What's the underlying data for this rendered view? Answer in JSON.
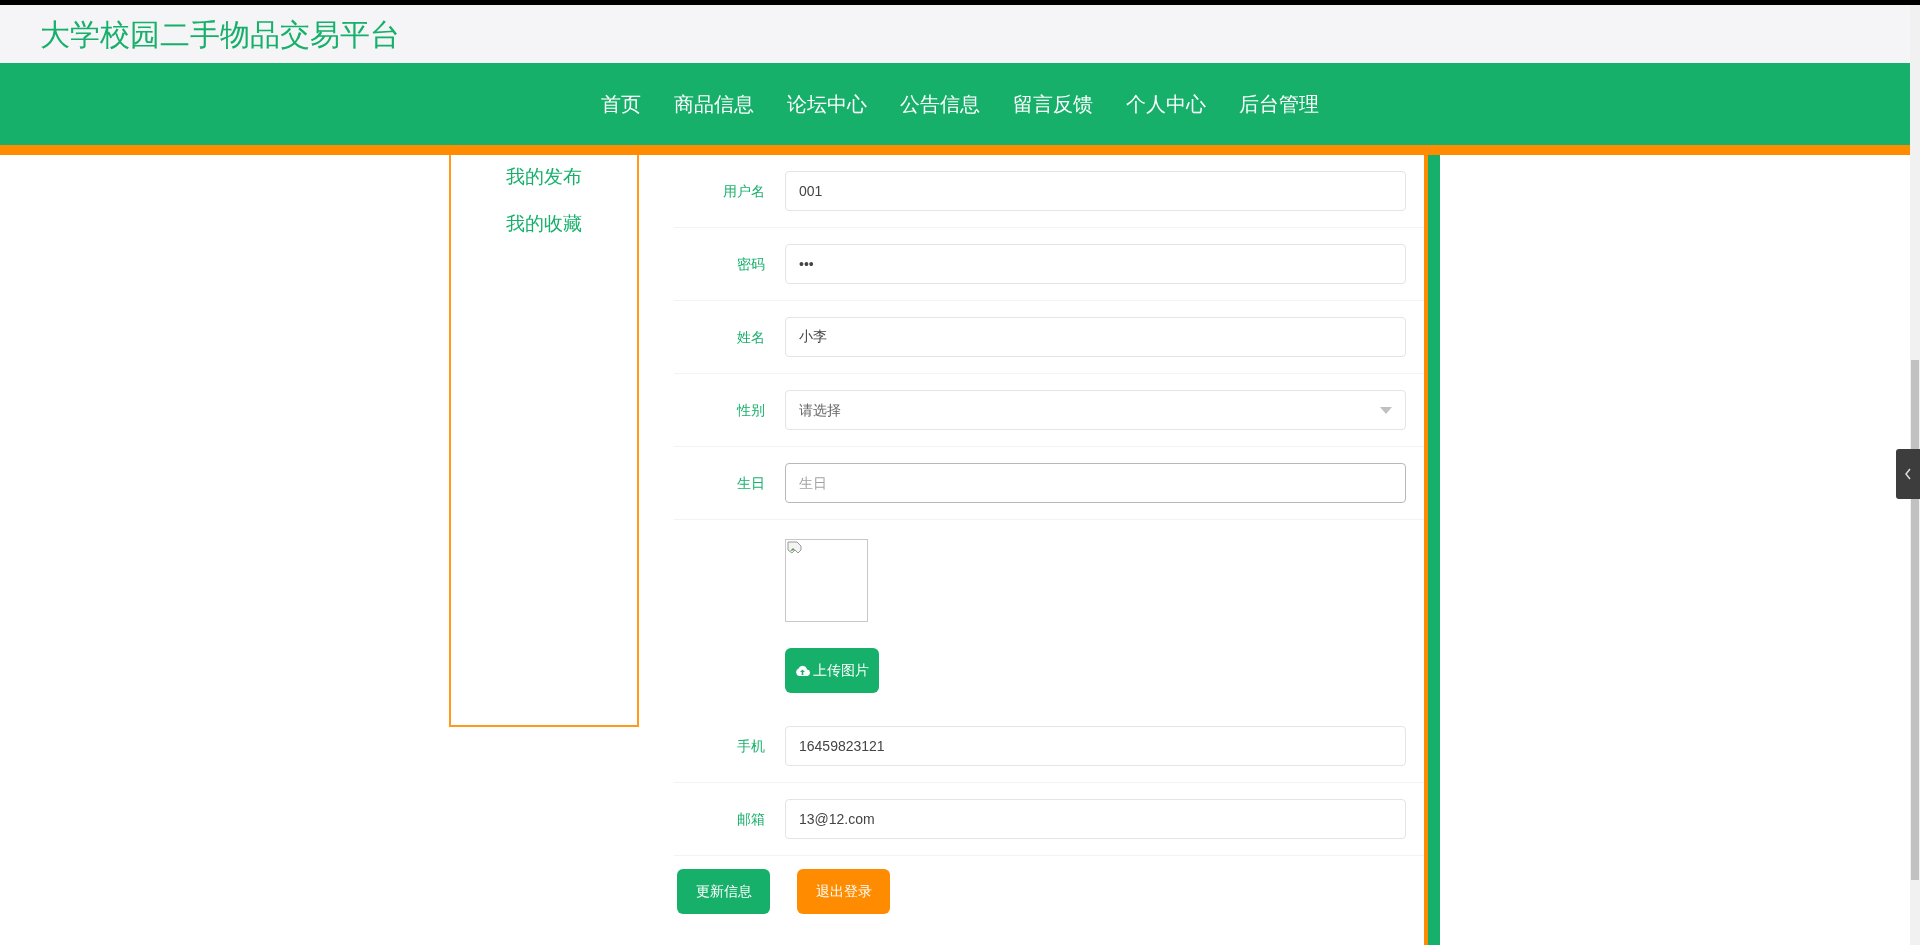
{
  "site_title": "大学校园二手物品交易平台",
  "nav": [
    {
      "label": "首页"
    },
    {
      "label": "商品信息"
    },
    {
      "label": "论坛中心"
    },
    {
      "label": "公告信息"
    },
    {
      "label": "留言反馈"
    },
    {
      "label": "个人中心"
    },
    {
      "label": "后台管理"
    }
  ],
  "sidebar": {
    "items": [
      {
        "label": "我的发布"
      },
      {
        "label": "我的收藏"
      }
    ]
  },
  "form": {
    "rows": [
      {
        "kind": "input",
        "label": "用户名",
        "value": "001"
      },
      {
        "kind": "input",
        "label": "密码",
        "value": "•••"
      },
      {
        "kind": "input",
        "label": "姓名",
        "value": "小李"
      },
      {
        "kind": "select",
        "label": "性别",
        "placeholder": "请选择"
      },
      {
        "kind": "input",
        "label": "生日",
        "placeholder": "生日",
        "focused": true
      },
      {
        "kind": "image"
      },
      {
        "kind": "upload",
        "label": "上传图片"
      },
      {
        "kind": "input",
        "label": "手机",
        "value": "16459823121"
      },
      {
        "kind": "input",
        "label": "邮箱",
        "value": "13@12.com"
      }
    ],
    "buttons": [
      {
        "label": "更新信息",
        "kind": "primary"
      },
      {
        "label": "退出登录",
        "kind": "warning"
      }
    ]
  }
}
